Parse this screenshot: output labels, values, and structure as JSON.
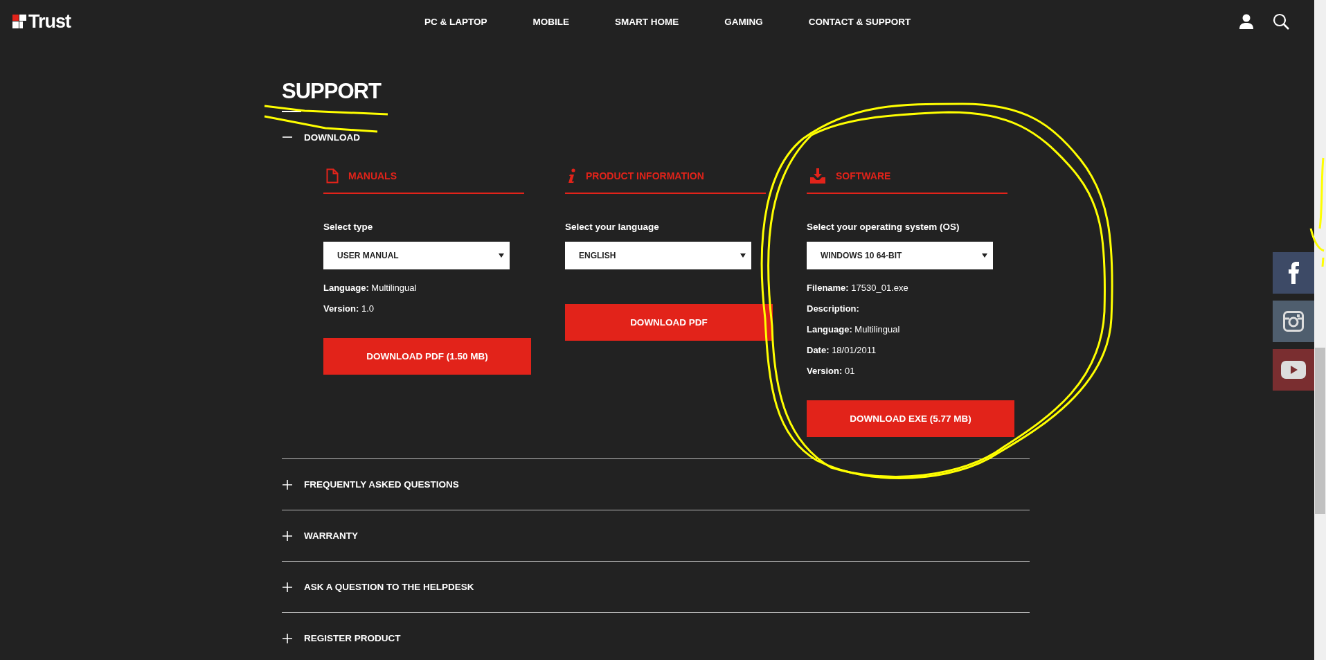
{
  "header": {
    "logo": "Trust",
    "nav": [
      "PC & LAPTOP",
      "MOBILE",
      "SMART HOME",
      "GAMING",
      "CONTACT & SUPPORT"
    ]
  },
  "page_title": "SUPPORT",
  "sections": [
    {
      "title": "DOWNLOAD",
      "expanded": true,
      "columns": [
        {
          "kind": "document",
          "title": "MANUALS",
          "field_label": "Select type",
          "value": "USER MANUAL",
          "details": [
            "**Language:** Multilingual",
            "**Version:** 1.0"
          ],
          "button": "DOWNLOAD PDF (1.50 MB)"
        },
        {
          "kind": "info",
          "title": "PRODUCT INFORMATION",
          "field_label": "Select your language",
          "value": "ENGLISH",
          "button": "DOWNLOAD PDF"
        },
        {
          "kind": "software",
          "title": "SOFTWARE",
          "field_label": "Select your operating system (OS)",
          "value": "WINDOWS 10 64-BIT",
          "details": [
            "**Filename:** 17530_01.exe",
            "**Description:**",
            "**Language:** Multilingual",
            "**Date:** 18/01/2011",
            "**Version:** 01"
          ],
          "button": "DOWNLOAD EXE (5.77 MB)"
        }
      ]
    },
    {
      "title": "FREQUENTLY ASKED QUESTIONS",
      "expanded": false
    },
    {
      "title": "WARRANTY",
      "expanded": false
    },
    {
      "title": "ASK A QUESTION TO THE HELPDESK",
      "expanded": false
    },
    {
      "title": "REGISTER PRODUCT",
      "expanded": false
    }
  ]
}
